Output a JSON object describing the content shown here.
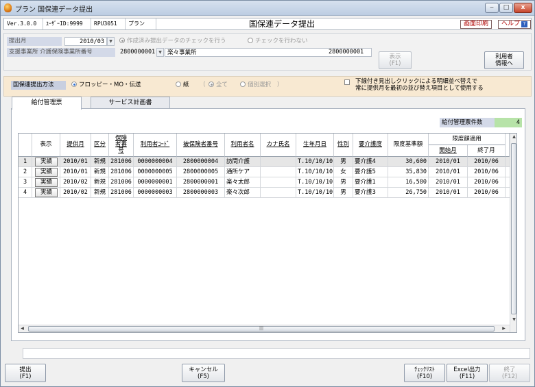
{
  "window": {
    "title": "プラン 国保連データ提出",
    "controls": {
      "minimize": "‒",
      "maximize": "□",
      "close": "x"
    }
  },
  "infobar": {
    "version": "Ver.3.0.0",
    "user_id": "ﾕｰｻﾞｰID:9999",
    "screen_code": "RPU3051",
    "product": "プラン",
    "screen_title": "国保連データ提出",
    "print_label": "画面印刷",
    "help_label": "ヘルプ",
    "help_icon": "?"
  },
  "criteria": {
    "month_label": "提出月",
    "month_value": "2010/03",
    "check_opt1": "作成済み提出データのチェックを行う",
    "check_opt2": "チェックを行わない",
    "office_label": "支援事業所 介護保険事業所番号",
    "office_code": "2800000001",
    "office_name": "楽々事業所",
    "office_code_right": "2800000001",
    "display_btn": {
      "label": "表示",
      "key": "(F1)"
    },
    "user_info_btn": {
      "line1": "利用者",
      "line2": "情報へ"
    }
  },
  "method": {
    "label": "国保連提出方法",
    "opt_floppy": "フロッピー・MO・伝送",
    "opt_paper": "紙",
    "paren_open": "（",
    "opt_all": "全て",
    "opt_individual": "個別選択",
    "paren_close": "）",
    "sort_check_line1": "下線付き見出しクリックによる明細並べ替えで",
    "sort_check_line2": "常に提供月を最初の並び替え項目として使用する"
  },
  "tabs": [
    "給付管理票",
    "サービス計画書"
  ],
  "count": {
    "label": "給付管理票件数",
    "value": "4"
  },
  "grid": {
    "headers": {
      "display": "表示",
      "month": "提供月",
      "category": "区分",
      "insurer": "保険者番号",
      "user_code": "利用者ｺｰﾄﾞ",
      "insured_no": "被保険者番号",
      "user_name": "利用者名",
      "kana": "カナ氏名",
      "birth": "生年月日",
      "sex": "性別",
      "care_level": "要介護度",
      "limit": "限度基準額",
      "limit_period": "限度額適用",
      "start_month": "開始月",
      "end_month": "終了月"
    },
    "rows": [
      {
        "no": "1",
        "btn": "実績",
        "month": "2010/01",
        "category": "新規",
        "insurer": "281006",
        "user_code": "0000000004",
        "insured_no": "2800000004",
        "user_name": "訪問介護",
        "kana": "",
        "birth": "T.10/10/10",
        "sex": "男",
        "care_level": "要介護4",
        "limit": "30,600",
        "start": "2010/01",
        "end": "2010/06"
      },
      {
        "no": "2",
        "btn": "実績",
        "month": "2010/01",
        "category": "新規",
        "insurer": "281006",
        "user_code": "0000000005",
        "insured_no": "2800000005",
        "user_name": "通所ケア",
        "kana": "",
        "birth": "T.10/10/10",
        "sex": "女",
        "care_level": "要介護5",
        "limit": "35,830",
        "start": "2010/01",
        "end": "2010/06"
      },
      {
        "no": "3",
        "btn": "実績",
        "month": "2010/02",
        "category": "新規",
        "insurer": "281006",
        "user_code": "0000000001",
        "insured_no": "2800000001",
        "user_name": "楽々太郎",
        "kana": "",
        "birth": "T.10/10/10",
        "sex": "男",
        "care_level": "要介護1",
        "limit": "16,580",
        "start": "2010/01",
        "end": "2010/06"
      },
      {
        "no": "4",
        "btn": "実績",
        "month": "2010/02",
        "category": "新規",
        "insurer": "281006",
        "user_code": "0000000003",
        "insured_no": "2800000003",
        "user_name": "楽々次郎",
        "kana": "",
        "birth": "T.10/10/10",
        "sex": "男",
        "care_level": "要介護3",
        "limit": "26,750",
        "start": "2010/01",
        "end": "2010/06"
      }
    ],
    "scroll_glyph": "|||"
  },
  "footer": {
    "submit": {
      "label": "提出",
      "key": "(F1)"
    },
    "cancel": {
      "label": "キャンセル",
      "key": "(F5)"
    },
    "checklist": {
      "label": "ﾁｪｯｸﾘｽﾄ",
      "key": "(F10)"
    },
    "excel": {
      "label": "Excel出力",
      "key": "(F11)"
    },
    "exit": {
      "label": "終了",
      "key": "(F12)"
    }
  }
}
